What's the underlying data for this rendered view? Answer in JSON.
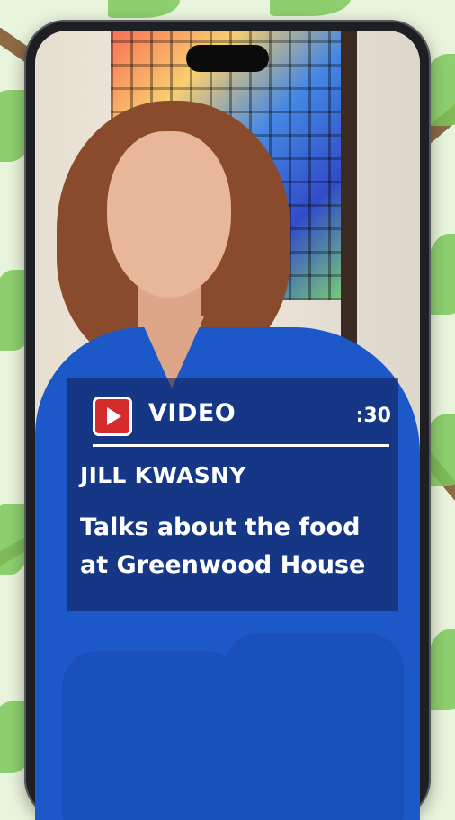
{
  "video_card": {
    "icon": "play-icon",
    "label": "VIDEO",
    "duration": ":30",
    "name": "JILL KWASNY",
    "description_line1": "Talks about the food",
    "description_line2": "at Greenwood House"
  },
  "colors": {
    "card_background": "#10235c",
    "play_button": "#d62b2b",
    "scrubs": "#1d58c9",
    "leaf_green": "#7cc85a"
  }
}
